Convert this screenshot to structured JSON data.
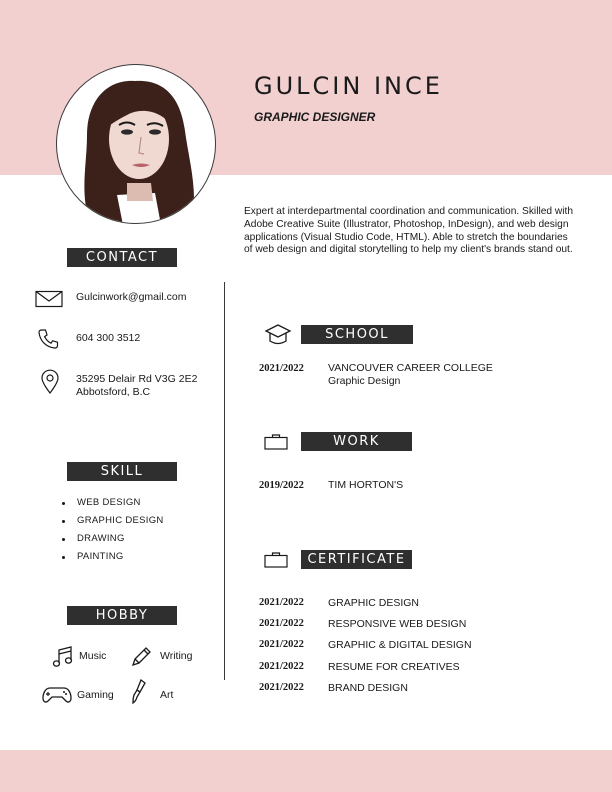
{
  "header": {
    "name": "GULCIN INCE",
    "title": "GRAPHIC DESIGNER",
    "summary": "Expert at interdepartmental coordination and communication. Skilled with Adobe Creative Suite (Illustrator, Photoshop, InDesign), and web design applications (Visual Studio Code, HTML). Able to stretch the boundaries of web design and digital storytelling to help my client's brands stand out."
  },
  "contact": {
    "heading": "CONTACT",
    "email": "Gulcinwork@gmail.com",
    "phone": "604 300 3512",
    "address_line1": "35295 Delair Rd V3G 2E2",
    "address_line2": "Abbotsford, B.C"
  },
  "skill": {
    "heading": "SKILL",
    "items": [
      "WEB DESIGN",
      "GRAPHIC DESIGN",
      "DRAWING",
      "PAINTING"
    ]
  },
  "hobby": {
    "heading": "HOBBY",
    "items": [
      {
        "label": "Music",
        "icon": "music-note-icon"
      },
      {
        "label": "Writing",
        "icon": "pen-icon"
      },
      {
        "label": "Gaming",
        "icon": "gamepad-icon"
      },
      {
        "label": "Art",
        "icon": "paintbrush-icon"
      }
    ]
  },
  "school": {
    "heading": "SCHOOL",
    "entries": [
      {
        "year": "2021/2022",
        "name": "VANCOUVER CAREER COLLEGE",
        "detail": "Graphic Design"
      }
    ]
  },
  "work": {
    "heading": "WORK",
    "entries": [
      {
        "year": "2019/2022",
        "name": "TIM HORTON'S"
      }
    ]
  },
  "certificate": {
    "heading": "CERTIFICATE",
    "entries": [
      {
        "year": "2021/2022",
        "name": "GRAPHIC DESIGN"
      },
      {
        "year": "2021/2022",
        "name": "RESPONSIVE WEB DESIGN"
      },
      {
        "year": "2021/2022",
        "name": "GRAPHIC & DIGITAL DESIGN"
      },
      {
        "year": "2021/2022",
        "name": "RESUME FOR CREATIVES"
      },
      {
        "year": "2021/2022",
        "name": "BRAND DESIGN"
      }
    ]
  },
  "colors": {
    "accent_pink": "#f3d0d0",
    "label_dark": "#2f2f2f",
    "text": "#1a1a1a"
  }
}
